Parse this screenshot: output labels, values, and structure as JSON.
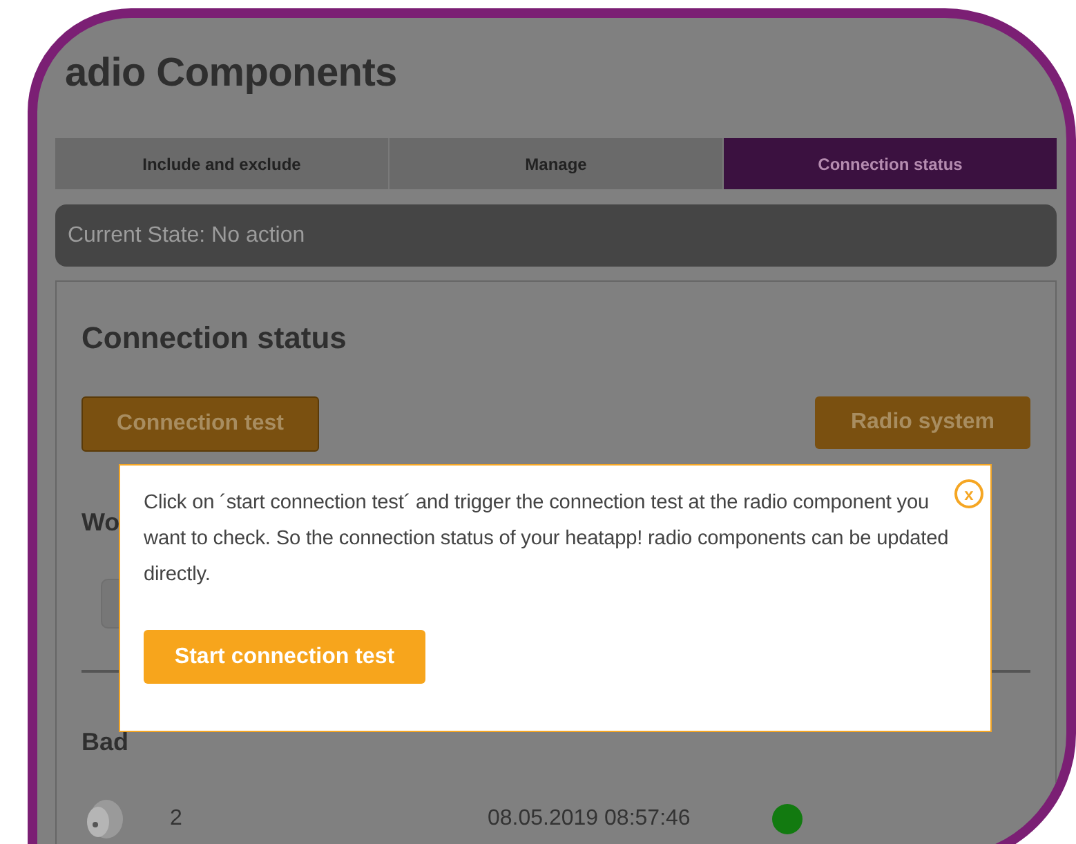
{
  "page": {
    "title": "adio Components"
  },
  "tabs": [
    {
      "label": "Include and exclude",
      "selected": false
    },
    {
      "label": "Manage",
      "selected": false
    },
    {
      "label": "Connection status",
      "selected": true
    }
  ],
  "state_bar": {
    "text": "Current State: No action"
  },
  "panel": {
    "heading": "Connection status",
    "buttons": [
      "Connection test",
      "Radio system"
    ],
    "section_1": "Wo",
    "section_2": "Bad",
    "rows": [
      {
        "name": "2",
        "time": "08.05.2019 08:57:46",
        "color": "#127a10"
      }
    ]
  },
  "dialog": {
    "message": "Click on ´start connection test´ and trigger the connection test at the radio component you want to check. So the connection status of your heatapp! radio components can be updated directly.",
    "button": "Start connection test",
    "close": "x"
  }
}
